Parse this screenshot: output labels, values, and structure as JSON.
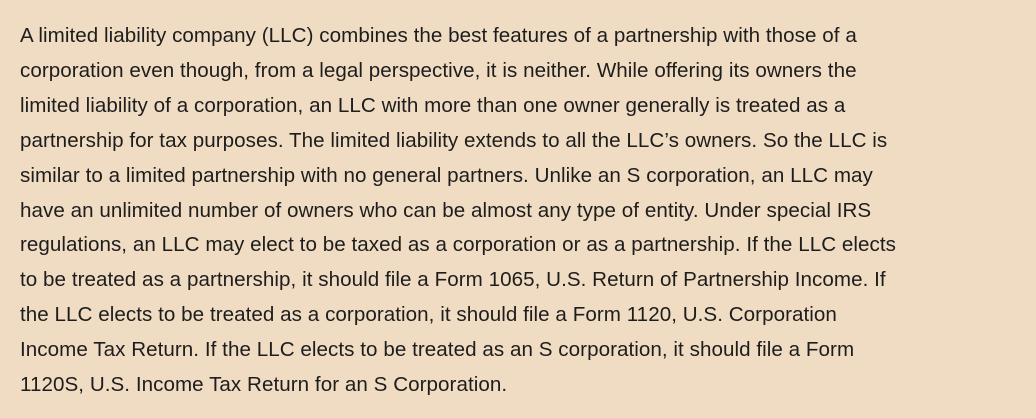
{
  "paragraph": {
    "lines": [
      "A limited liability company (LLC) combines the best features of a partnership with those of a",
      "corporation even though, from a legal perspective, it is neither. While offering its owners the",
      "limited liability of a corporation, an LLC with more than one owner generally is treated as a",
      "partnership for tax purposes. The limited liability extends to all the LLC’s owners. So the LLC is",
      "similar to a limited partnership with no general partners. Unlike an S corporation, an LLC may",
      "have an unlimited number of owners who can be almost any type of entity. Under special IRS",
      "regulations, an LLC may elect to be taxed as a corporation or as a partnership. If the LLC elects",
      "to be treated as a partnership, it should file a Form 1065, U.S. Return of Partnership Income. If",
      "the LLC elects to be treated as a corporation, it should file a Form 1120, U.S. Corporation",
      "Income Tax Return. If the LLC elects to be treated as an S corporation, it should file a Form",
      "1120S, U.S. Income Tax Return for an S Corporation."
    ]
  },
  "colors": {
    "background": "#f0dcc3",
    "text": "#1d1d1d"
  }
}
